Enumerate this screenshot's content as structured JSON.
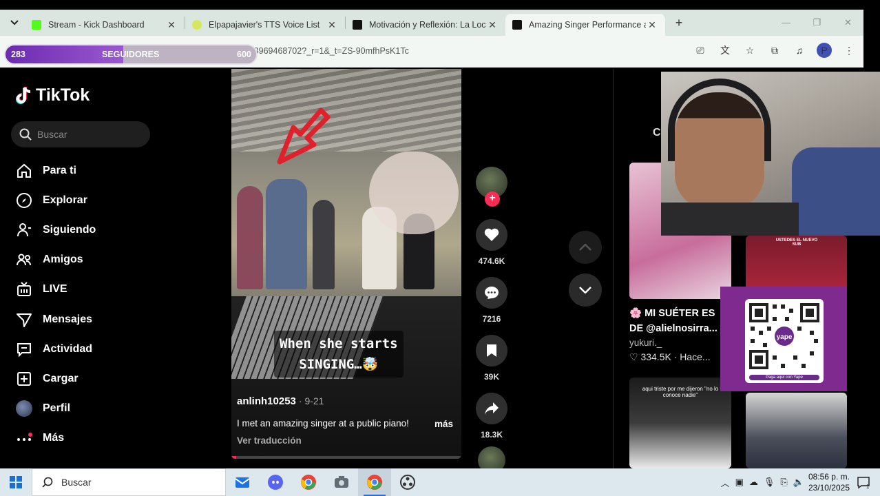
{
  "browser": {
    "tabs": [
      {
        "title": "Stream - Kick Dashboard",
        "color": "#53fc18",
        "active": false
      },
      {
        "title": "Elpapajavier's TTS Voice List",
        "color": "#d4e85a",
        "active": false
      },
      {
        "title": "Motivación y Reflexión: La Loco",
        "color": "#111111",
        "active": false
      },
      {
        "title": "Amazing Singer Performance at",
        "color": "#111111",
        "active": true
      }
    ],
    "url": "/@anlinh10253/video/7562673373969468702?_r=1&_t=ZS-90mfhPsK1Tc",
    "profile_initial": "P"
  },
  "followers_goal": {
    "current": "283",
    "label": "SEGUIDORES",
    "target": "600",
    "progress": 0.47
  },
  "tiktok": {
    "brand": "TikTok",
    "search_placeholder": "Buscar",
    "nav": [
      {
        "label": "Para ti",
        "icon": "home-icon"
      },
      {
        "label": "Explorar",
        "icon": "compass-icon"
      },
      {
        "label": "Siguiendo",
        "icon": "following-icon"
      },
      {
        "label": "Amigos",
        "icon": "friends-icon"
      },
      {
        "label": "LIVE",
        "icon": "live-icon"
      },
      {
        "label": "Mensajes",
        "icon": "messages-icon"
      },
      {
        "label": "Actividad",
        "icon": "activity-icon"
      },
      {
        "label": "Cargar",
        "icon": "upload-icon"
      },
      {
        "label": "Perfil",
        "icon": "profile-avatar"
      },
      {
        "label": "Más",
        "icon": "more-icon"
      }
    ]
  },
  "video": {
    "caption_line1": "When she starts",
    "caption_line2": "SINGING…🤯",
    "author": "anlinh10253",
    "date": "· 9-21",
    "description": "I met an amazing singer at a public piano!",
    "more": "más",
    "translate": "Ver traducción",
    "progress": 0.02
  },
  "actions": {
    "likes": "474.6K",
    "comments": "7216",
    "saves": "39K",
    "shares": "18.3K"
  },
  "right_column": {
    "letter": "C",
    "card_title": "🌸 MI SUÉTER ES DE @alielnosirra...",
    "card_user": "yukuri._",
    "card_likes": "♡ 334.5K · Hace...",
    "thumb2_text": "aqui triste por me dijeron \"no lo conoce nadie\"",
    "thumb1_text": "USTEDES EL NUEVO SUB"
  },
  "qr": {
    "label": "Paga aquí con Yape"
  },
  "taskbar": {
    "search_placeholder": "Buscar",
    "time": "08:56 p. m.",
    "date": "23/10/2025",
    "notifications": "1"
  }
}
